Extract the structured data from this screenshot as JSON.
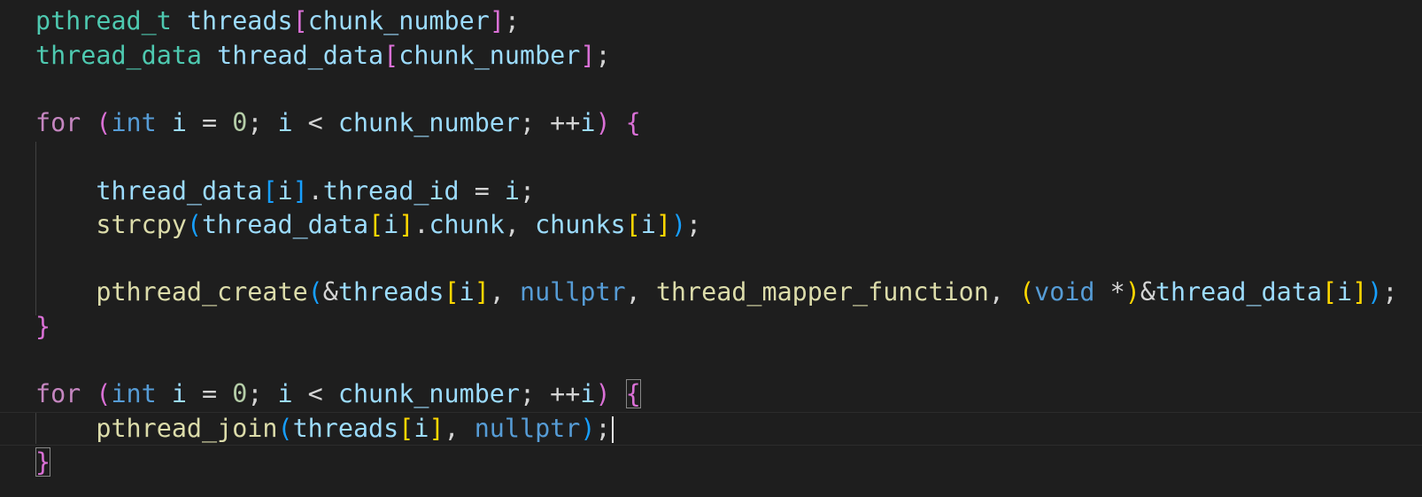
{
  "editor": {
    "lines": [
      [
        {
          "t": "pthread_t",
          "c": "tok-type"
        },
        {
          "t": " ",
          "c": ""
        },
        {
          "t": "threads",
          "c": "tok-var"
        },
        {
          "t": "[",
          "c": "tok-p1"
        },
        {
          "t": "chunk_number",
          "c": "tok-var"
        },
        {
          "t": "]",
          "c": "tok-p1"
        },
        {
          "t": ";",
          "c": "tok-op"
        }
      ],
      [
        {
          "t": "thread_data",
          "c": "tok-type"
        },
        {
          "t": " ",
          "c": ""
        },
        {
          "t": "thread_data",
          "c": "tok-var"
        },
        {
          "t": "[",
          "c": "tok-p1"
        },
        {
          "t": "chunk_number",
          "c": "tok-var"
        },
        {
          "t": "]",
          "c": "tok-p1"
        },
        {
          "t": ";",
          "c": "tok-op"
        }
      ],
      [],
      [
        {
          "t": "for",
          "c": "tok-kw"
        },
        {
          "t": " ",
          "c": ""
        },
        {
          "t": "(",
          "c": "tok-p1"
        },
        {
          "t": "int",
          "c": "tok-kw2"
        },
        {
          "t": " ",
          "c": ""
        },
        {
          "t": "i",
          "c": "tok-var"
        },
        {
          "t": " = ",
          "c": "tok-op"
        },
        {
          "t": "0",
          "c": "tok-num"
        },
        {
          "t": "; ",
          "c": "tok-op"
        },
        {
          "t": "i",
          "c": "tok-var"
        },
        {
          "t": " < ",
          "c": "tok-op"
        },
        {
          "t": "chunk_number",
          "c": "tok-var"
        },
        {
          "t": "; ++",
          "c": "tok-op"
        },
        {
          "t": "i",
          "c": "tok-var"
        },
        {
          "t": ")",
          "c": "tok-p1"
        },
        {
          "t": " ",
          "c": ""
        },
        {
          "t": "{",
          "c": "tok-p1"
        }
      ],
      [],
      [
        {
          "t": "    ",
          "c": ""
        },
        {
          "t": "thread_data",
          "c": "tok-var"
        },
        {
          "t": "[",
          "c": "tok-p2"
        },
        {
          "t": "i",
          "c": "tok-var"
        },
        {
          "t": "]",
          "c": "tok-p2"
        },
        {
          "t": ".",
          "c": "tok-op"
        },
        {
          "t": "thread_id",
          "c": "tok-var"
        },
        {
          "t": " = ",
          "c": "tok-op"
        },
        {
          "t": "i",
          "c": "tok-var"
        },
        {
          "t": ";",
          "c": "tok-op"
        }
      ],
      [
        {
          "t": "    ",
          "c": ""
        },
        {
          "t": "strcpy",
          "c": "tok-fn"
        },
        {
          "t": "(",
          "c": "tok-p2"
        },
        {
          "t": "thread_data",
          "c": "tok-var"
        },
        {
          "t": "[",
          "c": "tok-p3"
        },
        {
          "t": "i",
          "c": "tok-var"
        },
        {
          "t": "]",
          "c": "tok-p3"
        },
        {
          "t": ".",
          "c": "tok-op"
        },
        {
          "t": "chunk",
          "c": "tok-var"
        },
        {
          "t": ", ",
          "c": "tok-op"
        },
        {
          "t": "chunks",
          "c": "tok-var"
        },
        {
          "t": "[",
          "c": "tok-p3"
        },
        {
          "t": "i",
          "c": "tok-var"
        },
        {
          "t": "]",
          "c": "tok-p3"
        },
        {
          "t": ")",
          "c": "tok-p2"
        },
        {
          "t": ";",
          "c": "tok-op"
        }
      ],
      [],
      [
        {
          "t": "    ",
          "c": ""
        },
        {
          "t": "pthread_create",
          "c": "tok-fn"
        },
        {
          "t": "(",
          "c": "tok-p2"
        },
        {
          "t": "&",
          "c": "tok-op"
        },
        {
          "t": "threads",
          "c": "tok-var"
        },
        {
          "t": "[",
          "c": "tok-p3"
        },
        {
          "t": "i",
          "c": "tok-var"
        },
        {
          "t": "]",
          "c": "tok-p3"
        },
        {
          "t": ", ",
          "c": "tok-op"
        },
        {
          "t": "nullptr",
          "c": "tok-kw2"
        },
        {
          "t": ", ",
          "c": "tok-op"
        },
        {
          "t": "thread_mapper_function",
          "c": "tok-fn"
        },
        {
          "t": ", ",
          "c": "tok-op"
        },
        {
          "t": "(",
          "c": "tok-p3"
        },
        {
          "t": "void",
          "c": "tok-kw2"
        },
        {
          "t": " *",
          "c": "tok-op"
        },
        {
          "t": ")",
          "c": "tok-p3"
        },
        {
          "t": "&",
          "c": "tok-op"
        },
        {
          "t": "thread_data",
          "c": "tok-var"
        },
        {
          "t": "[",
          "c": "tok-p3"
        },
        {
          "t": "i",
          "c": "tok-var"
        },
        {
          "t": "]",
          "c": "tok-p3"
        },
        {
          "t": ")",
          "c": "tok-p2"
        },
        {
          "t": ";",
          "c": "tok-op"
        }
      ],
      [
        {
          "t": "}",
          "c": "tok-p1"
        }
      ],
      [],
      [
        {
          "t": "for",
          "c": "tok-kw"
        },
        {
          "t": " ",
          "c": ""
        },
        {
          "t": "(",
          "c": "tok-p1"
        },
        {
          "t": "int",
          "c": "tok-kw2"
        },
        {
          "t": " ",
          "c": ""
        },
        {
          "t": "i",
          "c": "tok-var"
        },
        {
          "t": " = ",
          "c": "tok-op"
        },
        {
          "t": "0",
          "c": "tok-num"
        },
        {
          "t": "; ",
          "c": "tok-op"
        },
        {
          "t": "i",
          "c": "tok-var"
        },
        {
          "t": " < ",
          "c": "tok-op"
        },
        {
          "t": "chunk_number",
          "c": "tok-var"
        },
        {
          "t": "; ++",
          "c": "tok-op"
        },
        {
          "t": "i",
          "c": "tok-var"
        },
        {
          "t": ")",
          "c": "tok-p1"
        },
        {
          "t": " ",
          "c": ""
        },
        {
          "t": "{",
          "c": "tok-p1 bracket-match"
        }
      ],
      [
        {
          "t": "    ",
          "c": ""
        },
        {
          "t": "pthread_join",
          "c": "tok-fn"
        },
        {
          "t": "(",
          "c": "tok-p2"
        },
        {
          "t": "threads",
          "c": "tok-var"
        },
        {
          "t": "[",
          "c": "tok-p3"
        },
        {
          "t": "i",
          "c": "tok-var"
        },
        {
          "t": "]",
          "c": "tok-p3"
        },
        {
          "t": ", ",
          "c": "tok-op"
        },
        {
          "t": "nullptr",
          "c": "tok-kw2"
        },
        {
          "t": ")",
          "c": "tok-p2"
        },
        {
          "t": ";",
          "c": "tok-op"
        }
      ],
      [
        {
          "t": "}",
          "c": "tok-p1 bracket-match"
        }
      ]
    ],
    "current_line": 12,
    "cursor_line": 12
  }
}
